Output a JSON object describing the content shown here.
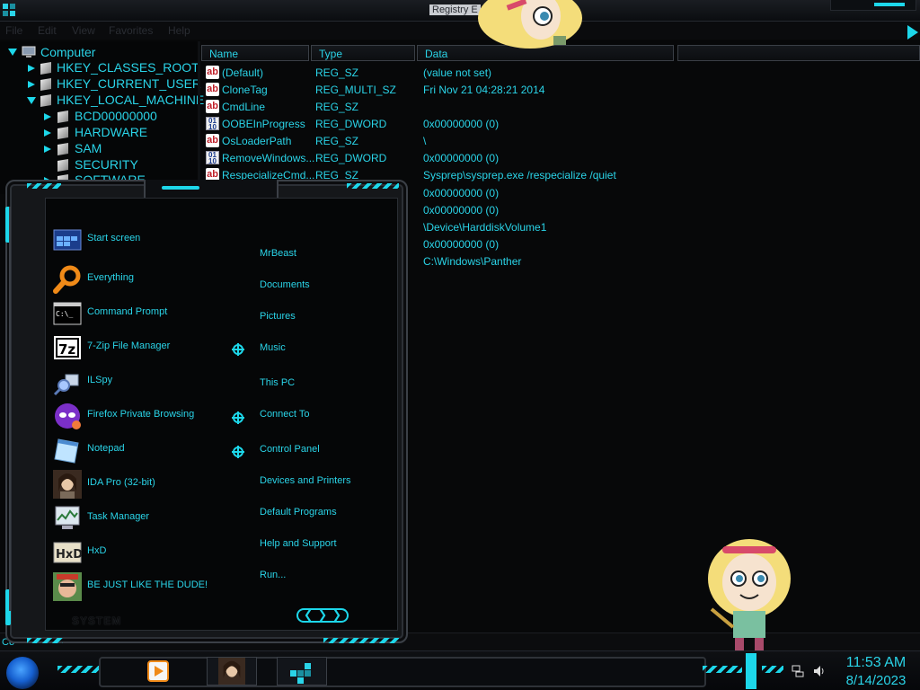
{
  "window": {
    "title": "Registry E",
    "menu": [
      "File",
      "Edit",
      "View",
      "Favorites",
      "Help"
    ]
  },
  "tree": {
    "root": "Computer",
    "hives": [
      "HKEY_CLASSES_ROOT",
      "HKEY_CURRENT_USER",
      "HKEY_LOCAL_MACHINE"
    ],
    "subkeys": [
      "BCD00000000",
      "HARDWARE",
      "SAM",
      "SECURITY",
      "SOFTWARE"
    ]
  },
  "list": {
    "columns": [
      "Name",
      "Type",
      "Data"
    ],
    "rows": [
      {
        "icon": "string-value-icon",
        "name": "(Default)",
        "type": "REG_SZ",
        "data": "(value not set)"
      },
      {
        "icon": "string-value-icon",
        "name": "CloneTag",
        "type": "REG_MULTI_SZ",
        "data": "Fri Nov 21 04:28:21 2014"
      },
      {
        "icon": "string-value-icon",
        "name": "CmdLine",
        "type": "REG_SZ",
        "data": ""
      },
      {
        "icon": "binary-value-icon",
        "name": "OOBEInProgress",
        "type": "REG_DWORD",
        "data": "0x00000000 (0)"
      },
      {
        "icon": "string-value-icon",
        "name": "OsLoaderPath",
        "type": "REG_SZ",
        "data": "\\"
      },
      {
        "icon": "binary-value-icon",
        "name": "RemoveWindows...",
        "type": "REG_DWORD",
        "data": "0x00000000 (0)"
      },
      {
        "icon": "string-value-icon",
        "name": "RespecializeCmd...",
        "type": "REG_SZ",
        "data": "Sysprep\\sysprep.exe /respecialize /quiet"
      }
    ],
    "data_only": [
      "0x00000000 (0)",
      "0x00000000 (0)",
      "\\Device\\HarddiskVolume1",
      "0x00000000 (0)",
      "C:\\Windows\\Panther"
    ]
  },
  "statusbar": {
    "text": "Co"
  },
  "start_menu": {
    "programs": [
      {
        "label": "Start screen",
        "icon": "start-screen-icon"
      },
      {
        "label": "Everything",
        "icon": "magnifier-icon"
      },
      {
        "label": "Command Prompt",
        "icon": "command-prompt-icon"
      },
      {
        "label": "7-Zip File Manager",
        "icon": "7zip-icon"
      },
      {
        "label": "ILSpy",
        "icon": "ilspy-icon"
      },
      {
        "label": "Firefox Private Browsing",
        "icon": "firefox-private-icon"
      },
      {
        "label": "Notepad",
        "icon": "notepad-icon"
      },
      {
        "label": "IDA Pro (32-bit)",
        "icon": "ida-pro-icon"
      },
      {
        "label": "Task Manager",
        "icon": "task-manager-icon"
      },
      {
        "label": "HxD",
        "icon": "hxd-icon"
      },
      {
        "label": "BE JUST LIKE THE DUDE!",
        "icon": "dude-icon"
      }
    ],
    "places": [
      "MrBeast",
      "Documents",
      "Pictures",
      "Music",
      "This PC",
      "Connect To",
      "Control Panel",
      "Devices and Printers",
      "Default Programs",
      "Help and Support",
      "Run..."
    ],
    "system_label": "SYSTEM"
  },
  "taskbar": {
    "time": "11:53 AM",
    "date": "8/14/2023"
  },
  "theme": {
    "accent": "#1dd7ea",
    "text": "#2ad4e8",
    "background": "#050608"
  }
}
